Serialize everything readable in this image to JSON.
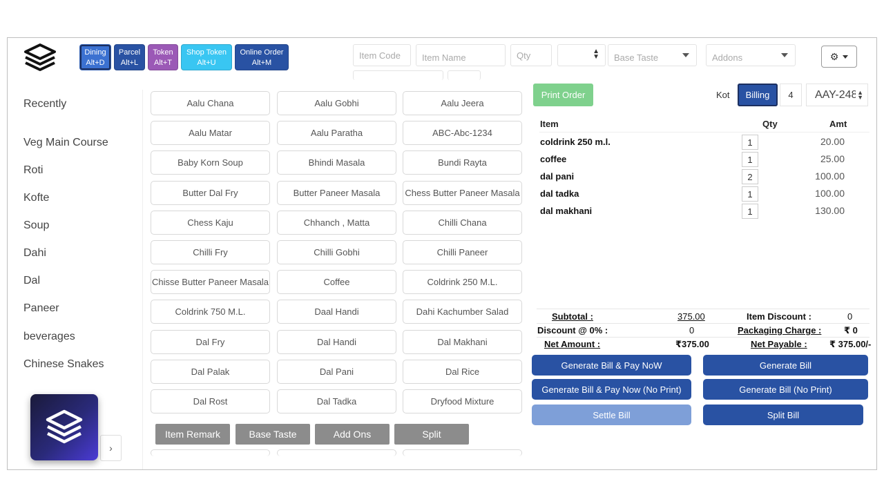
{
  "header": {
    "modes": [
      {
        "label": "Dining",
        "shortcut": "Alt+D"
      },
      {
        "label": "Parcel",
        "shortcut": "Alt+L"
      },
      {
        "label": "Token",
        "shortcut": "Alt+T"
      },
      {
        "label": "Shop Token",
        "shortcut": "Alt+U"
      },
      {
        "label": "Online Order",
        "shortcut": "Alt+M"
      }
    ],
    "item_code_placeholder": "Item Code",
    "item_name_placeholder": "Item Name",
    "qty_placeholder": "Qty",
    "base_taste_placeholder": "Base Taste",
    "addons_placeholder": "Addons",
    "settings_icon": "gear-icon"
  },
  "sidebar": {
    "categories": [
      "Recently",
      "Veg Main Course",
      "Roti",
      "Kofte",
      "Soup",
      "Dahi",
      "Dal",
      "Paneer",
      "beverages",
      "Chinese Snakes"
    ],
    "next_label": "›"
  },
  "items": [
    "Aalu Chana",
    "Aalu Gobhi",
    "Aalu Jeera",
    "Aalu Matar",
    "Aalu Paratha",
    "ABC-Abc-1234",
    "Baby Korn Soup",
    "Bhindi Masala",
    "Bundi Rayta",
    "Butter Dal Fry",
    "Butter Paneer Masala",
    "Chess Butter Paneer Masala",
    "Chess Kaju",
    "Chhanch , Matta",
    "Chilli Chana",
    "Chilli Fry",
    "Chilli Gobhi",
    "Chilli Paneer",
    "Chisse Butter Paneer Masala",
    "Coffee",
    "Coldrink 250 M.L.",
    "Coldrink 750 M.L.",
    "Daal Handi",
    "Dahi Kachumber Salad",
    "Dal Fry",
    "Dal Handi",
    "Dal Makhani",
    "Dal Palak",
    "Dal Pani",
    "Dal Rice",
    "Dal Rost",
    "Dal Tadka",
    "Dryfood Mixture"
  ],
  "actions": [
    "Item Remark",
    "Base Taste",
    "Add Ons",
    "Split"
  ],
  "order": {
    "print_label": "Print Order",
    "kot_label": "Kot",
    "billing_label": "Billing",
    "table_number": "4",
    "bill_select_value": "AAY-248",
    "columns": {
      "item": "Item",
      "qty": "Qty",
      "amt": "Amt"
    },
    "rows": [
      {
        "name": "coldrink 250 m.l.",
        "qty": "1",
        "amt": "20.00"
      },
      {
        "name": "coffee",
        "qty": "1",
        "amt": "25.00"
      },
      {
        "name": "dal pani",
        "qty": "2",
        "amt": "100.00"
      },
      {
        "name": "dal tadka",
        "qty": "1",
        "amt": "100.00"
      },
      {
        "name": "dal makhani",
        "qty": "1",
        "amt": "130.00"
      }
    ]
  },
  "summary": {
    "subtotal_label": "Subtotal :",
    "subtotal_value": "375.00",
    "item_discount_label": "Item Discount :",
    "item_discount_value": "0",
    "discount_label": "Discount @ 0% :",
    "discount_value": "0",
    "packaging_label": "Packaging Charge :",
    "packaging_value": "₹ 0",
    "net_amount_label": "Net Amount :",
    "net_amount_value": "₹375.00",
    "net_payable_label": "Net Payable :",
    "net_payable_value": "₹ 375.00/-"
  },
  "bill_buttons": {
    "gen_pay_now": "Generate Bill & Pay NoW",
    "gen_bill": "Generate Bill",
    "gen_pay_now_noprint": "Generate Bill & Pay Now (No Print)",
    "gen_bill_noprint": "Generate Bill (No Print)",
    "settle": "Settle Bill",
    "split": "Split Bill"
  },
  "colors": {
    "primary": "#2952a3",
    "dining_active": "#3b71d1",
    "token": "#9b59b6",
    "shop_token": "#39c6f2",
    "print_order": "#7fd18d",
    "settle_disabled": "#7e9fd8",
    "action_grey": "#8c8c8c"
  }
}
